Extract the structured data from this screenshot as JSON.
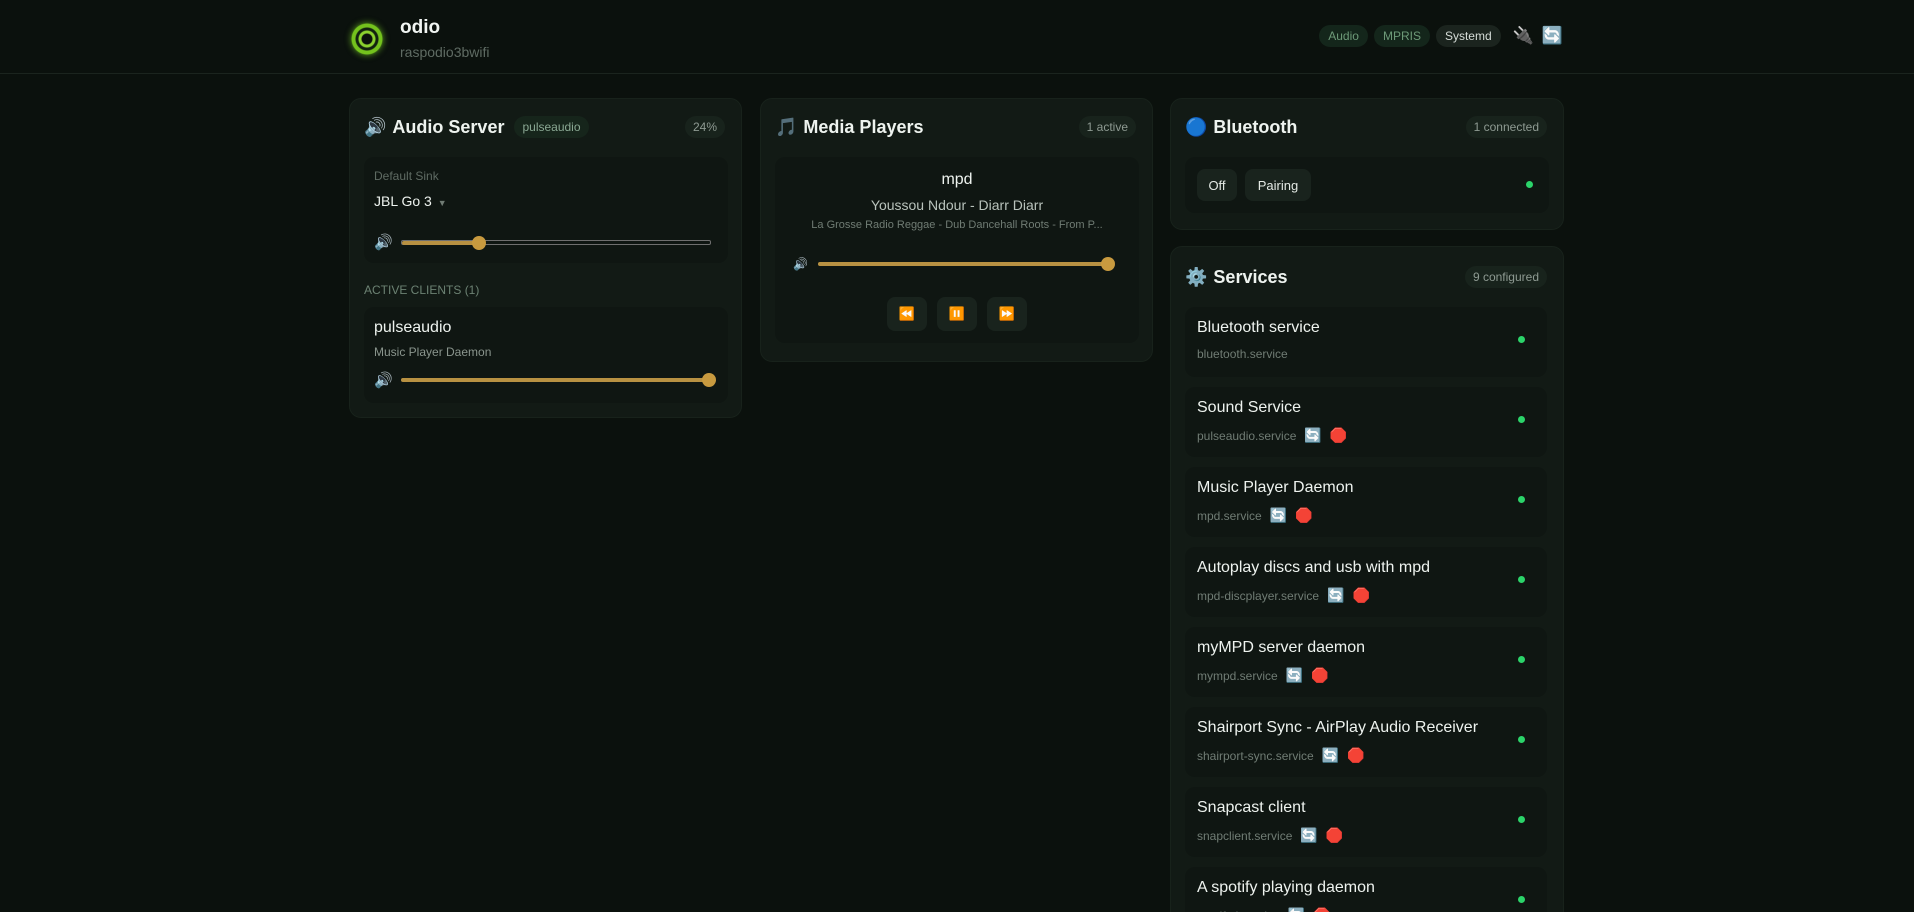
{
  "header": {
    "app_name": "odio",
    "hostname": "raspodio3bwifi",
    "nav": [
      "Audio",
      "MPRIS",
      "Systemd"
    ],
    "icons": [
      "plug-icon",
      "refresh-icon"
    ]
  },
  "audio": {
    "title": "Audio Server",
    "server_badge": "pulseaudio",
    "volume_badge": "24%",
    "default_sink_label": "Default Sink",
    "default_sink": "JBL Go 3",
    "sink_volume": 0.25,
    "clients_header": "ACTIVE CLIENTS (1)",
    "clients": [
      {
        "name": "pulseaudio",
        "description": "Music Player Daemon",
        "volume": 1.0
      }
    ]
  },
  "media": {
    "title": "Media Players",
    "badge": "1 active",
    "player": {
      "name": "mpd",
      "track": "Youssou Ndour - Diarr Diarr",
      "album": "La Grosse Radio Reggae - Dub Dancehall Roots - From P...",
      "volume": 1.0,
      "controls": [
        "⏪",
        "⏸️",
        "⏩"
      ]
    }
  },
  "bluetooth": {
    "title": "Bluetooth",
    "badge": "1 connected",
    "buttons": [
      "Off",
      "Pairing"
    ],
    "status_color": "#2bd46a"
  },
  "services": {
    "title": "Services",
    "badge": "9 configured",
    "items": [
      {
        "name": "Bluetooth service",
        "unit": "bluetooth.service",
        "actions": false
      },
      {
        "name": "Sound Service",
        "unit": "pulseaudio.service",
        "actions": true
      },
      {
        "name": "Music Player Daemon",
        "unit": "mpd.service",
        "actions": true
      },
      {
        "name": "Autoplay discs and usb with mpd",
        "unit": "mpd-discplayer.service",
        "actions": true
      },
      {
        "name": "myMPD server daemon",
        "unit": "mympd.service",
        "actions": true
      },
      {
        "name": "Shairport Sync - AirPlay Audio Receiver",
        "unit": "shairport-sync.service",
        "actions": true
      },
      {
        "name": "Snapcast client",
        "unit": "snapclient.service",
        "actions": true
      },
      {
        "name": "A spotify playing daemon",
        "unit": "spotifyd.service",
        "actions": true
      }
    ]
  },
  "colors": {
    "accent": "#c89a3f",
    "status_ok": "#2bd46a",
    "background": "#0b110d"
  }
}
